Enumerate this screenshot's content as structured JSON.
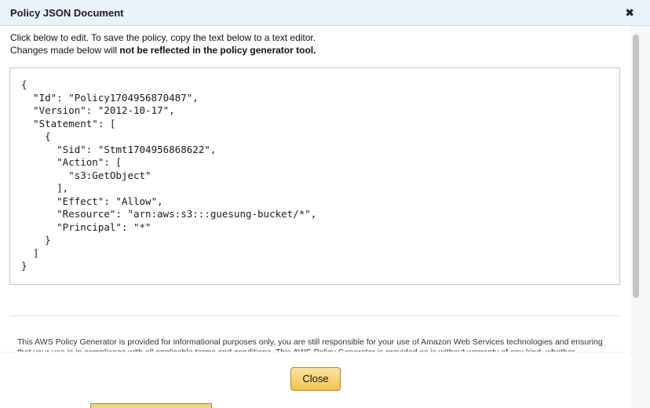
{
  "dialog": {
    "title": "Policy JSON Document",
    "close_icon": "close-icon",
    "close_glyph": "✖",
    "instructions_line1": "Click below to edit. To save the policy, copy the text below to a text editor.",
    "instructions_line2_prefix": "Changes made below will ",
    "instructions_line2_bold": "not be reflected in the policy generator tool.",
    "policy_json": "{\n  \"Id\": \"Policy1704956870487\",\n  \"Version\": \"2012-10-17\",\n  \"Statement\": [\n    {\n      \"Sid\": \"Stmt1704956868622\",\n      \"Action\": [\n        \"s3:GetObject\"\n      ],\n      \"Effect\": \"Allow\",\n      \"Resource\": \"arn:aws:s3:::guesung-bucket/*\",\n      \"Principal\": \"*\"\n    }\n  ]\n}",
    "disclaimer": "This AWS Policy Generator is provided for informational purposes only, you are still responsible for your use of Amazon Web Services technologies and ensuring that your use is in compliance with all applicable terms and conditions. This AWS Policy Generator is provided as is without warranty of any kind, whether",
    "close_button_label": "Close"
  },
  "colors": {
    "titlebar_bg": "#e9f1fb",
    "button_gradient_top": "#fbe3a3",
    "button_gradient_bottom": "#f1c54c",
    "button_border": "#a88734"
  }
}
